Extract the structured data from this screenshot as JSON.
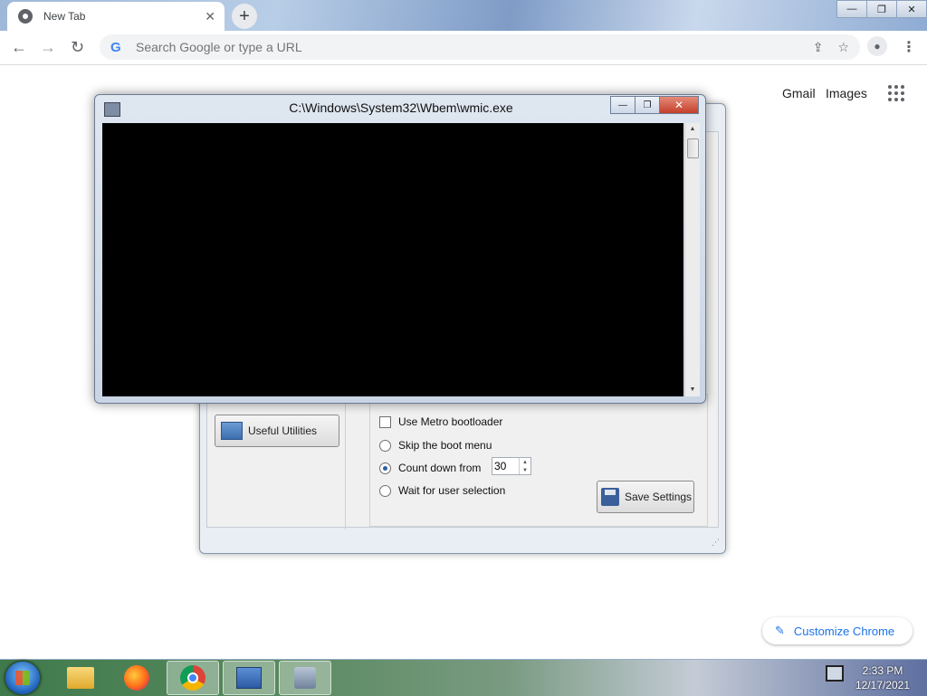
{
  "browser": {
    "tab_title": "New Tab",
    "tab_close": "✕",
    "new_tab": "+",
    "omnibox_placeholder": "Search Google or type a URL",
    "window_controls": {
      "minimize": "—",
      "restore": "❐",
      "close": "✕"
    },
    "nav": {
      "back": "←",
      "forward": "→",
      "reload": "↻"
    }
  },
  "ntp": {
    "gmail": "Gmail",
    "images": "Images",
    "customize": "Customize Chrome"
  },
  "console": {
    "title": "C:\\Windows\\System32\\Wbem\\wmic.exe",
    "min": "—",
    "max": "❐",
    "close": "✕"
  },
  "dialog": {
    "useful_utilities": "Useful Utilities",
    "use_metro_bootloader": "Use Metro bootloader",
    "skip_boot_menu": "Skip the boot menu",
    "count_down_from": "Count down from",
    "countdown_value": "30",
    "wait_for_user": "Wait for user selection",
    "save_settings": "Save Settings"
  },
  "taskbar": {
    "time": "2:33 PM",
    "date": "12/17/2021"
  }
}
